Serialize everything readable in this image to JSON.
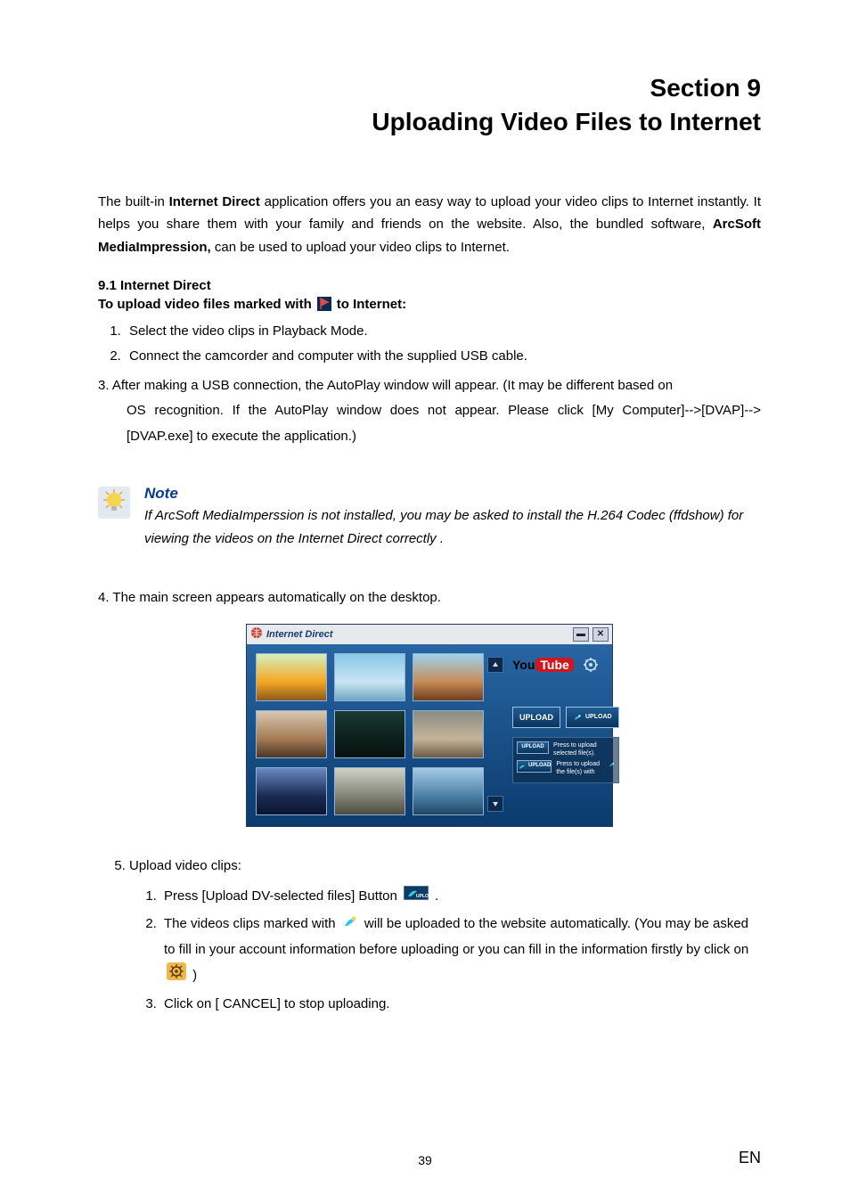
{
  "header": {
    "section_line1": "Section 9",
    "section_line2": "Uploading Video Files to Internet"
  },
  "intro": {
    "prefix": "The built-in ",
    "bold1": "Internet Direct",
    "mid1": " application offers you an easy way to upload your video clips to Internet instantly. It helps you share them with your family and friends on the website. Also, the bundled software, ",
    "bold2": "ArcSoft MediaImpression,",
    "suffix": " can be used to upload your video clips to Internet."
  },
  "s91": {
    "title": "9.1 Internet Direct",
    "upload_prefix": "To upload video files marked with",
    "upload_suffix": "to Internet:"
  },
  "steps123": {
    "s1": "Select the video clips in Playback Mode.",
    "s2": "Connect the camcorder and computer with the supplied USB cable.",
    "s3_head": "3. After making a USB connection, the AutoPlay window will appear. (It may be different based on",
    "s3_body": "OS recognition. If the AutoPlay window does not appear. Please click [My Computer]-->[DVAP]-->[DVAP.exe] to execute the application.)"
  },
  "note": {
    "title": "Note",
    "text": "If ArcSoft MediaImperssion is not installed, you may be asked to install the H.264 Codec (ffdshow) for viewing the videos on the Internet Direct correctly ."
  },
  "step4": "4. The main screen appears automatically on the desktop.",
  "app": {
    "title": "Internet Direct",
    "min": "▬",
    "close": "✕",
    "yt_you": "You",
    "yt_tube": "Tube",
    "upload_btn": "UPLOAD",
    "dv_upload_btn": "UPLOAD",
    "legend1_btn": "UPLOAD",
    "legend1_text": "Press to upload selected file(s).",
    "legend2_text": "Press to upload the file(s) with"
  },
  "step5": {
    "head": "Upload video clips:",
    "s1_prefix": "Press [Upload DV-selected files] Button",
    "s1_suffix": ".",
    "s2_prefix": "The videos clips marked with",
    "s2_mid": "will be uploaded to the website automatically. (You may be asked to fill in your account information before uploading or you can fill in the information firstly by click on",
    "s2_suffix": ")",
    "s3": "Click on [ CANCEL] to stop uploading."
  },
  "footer": {
    "page": "39",
    "lang": "EN"
  }
}
